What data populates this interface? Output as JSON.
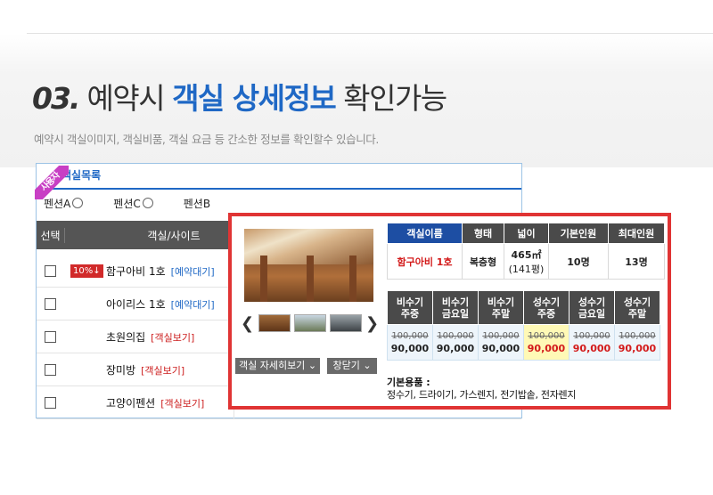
{
  "headline": {
    "number": "03.",
    "part1": "예약시",
    "highlight": "객실 상세정보",
    "part2": "확인가능"
  },
  "subtitle": "예약시 객실이미지, 객실비품, 객실 요금 등 간소한 정보를 확인할수 있습니다.",
  "panel": {
    "ribbon": "사용자",
    "header": "객실목록",
    "radios": [
      "펜션A",
      "펜션C",
      "펜션B"
    ],
    "columns": [
      "선택",
      "객실/사이트"
    ],
    "rows": [
      {
        "badge": "10%↓",
        "name": "함구아비 1호",
        "link": "[예약대기]",
        "link_color": "blue"
      },
      {
        "badge": "",
        "name": "아이리스 1호",
        "link": "[예약대기]",
        "link_color": "blue"
      },
      {
        "badge": "",
        "name": "초원의집",
        "link": "[객실보기]",
        "link_color": "red"
      },
      {
        "badge": "",
        "name": "장미방",
        "link": "[객실보기]",
        "link_color": "red"
      },
      {
        "badge": "",
        "name": "고양이펜션",
        "link": "[객실보기]",
        "link_color": "red"
      }
    ]
  },
  "popup": {
    "detail_button": "객실 자세히보기",
    "close_button": "창닫기",
    "info_headers": [
      "객실이름",
      "형태",
      "넓이",
      "기본인원",
      "최대인원"
    ],
    "info_values": {
      "name": "함구아비 1호",
      "type": "복층형",
      "area": "465㎡",
      "area_pyeong": "(141평)",
      "base": "10명",
      "max": "13명"
    },
    "price_headers": [
      [
        "비수기",
        "주중"
      ],
      [
        "비수기",
        "금요일"
      ],
      [
        "비수기",
        "주말"
      ],
      [
        "성수기",
        "주중"
      ],
      [
        "성수기",
        "금요일"
      ],
      [
        "성수기",
        "주말"
      ]
    ],
    "prices": [
      {
        "original": "100,000",
        "sale": "90,000"
      },
      {
        "original": "100,000",
        "sale": "90,000"
      },
      {
        "original": "100,000",
        "sale": "90,000"
      },
      {
        "original": "100,000",
        "sale": "90,000"
      },
      {
        "original": "100,000",
        "sale": "90,000"
      },
      {
        "original": "100,000",
        "sale": "90,000"
      }
    ],
    "amenities_title": "기본용품 :",
    "amenities": "정수기, 드라이기, 가스렌지, 전기밥솥, 전자렌지"
  },
  "colors": {
    "accent_blue": "#1f68c5",
    "popup_border": "#e03434",
    "ribbon": "#c83fc4",
    "highlight_cell": "#fff9b6"
  }
}
